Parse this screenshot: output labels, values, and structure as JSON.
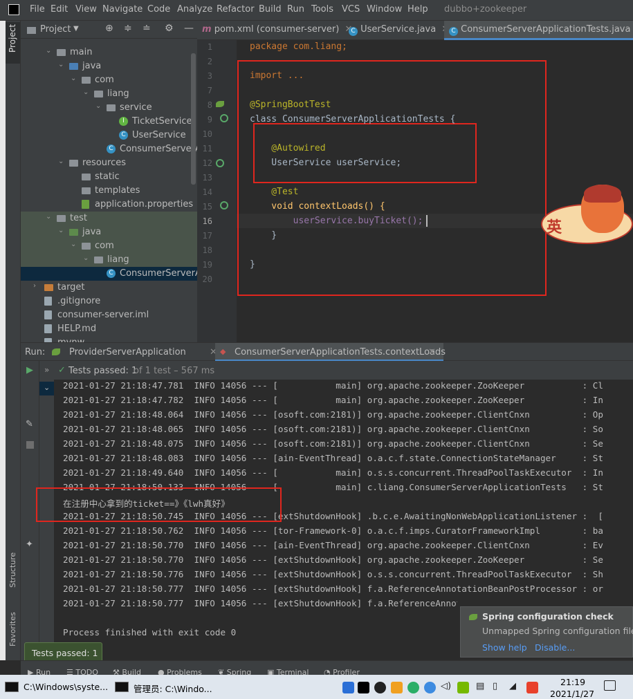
{
  "menubar": {
    "items": [
      "File",
      "Edit",
      "View",
      "Navigate",
      "Code",
      "Analyze",
      "Refactor",
      "Build",
      "Run",
      "Tools",
      "VCS",
      "Window",
      "Help"
    ],
    "project_title": "dubbo+zookeeper"
  },
  "project_panel": {
    "title": "Project",
    "side_label": "Project",
    "tree": [
      {
        "label": "main",
        "type": "folder",
        "depth": 0,
        "expanded": true
      },
      {
        "label": "java",
        "type": "source-folder",
        "depth": 1,
        "expanded": true
      },
      {
        "label": "com",
        "type": "package",
        "depth": 2,
        "expanded": true
      },
      {
        "label": "liang",
        "type": "package",
        "depth": 3,
        "expanded": true
      },
      {
        "label": "service",
        "type": "package",
        "depth": 4,
        "expanded": true
      },
      {
        "label": "TicketService",
        "type": "interface",
        "depth": 5
      },
      {
        "label": "UserService",
        "type": "class",
        "depth": 5
      },
      {
        "label": "ConsumerServerAp",
        "type": "class",
        "depth": 4
      },
      {
        "label": "resources",
        "type": "folder",
        "depth": 1,
        "expanded": true
      },
      {
        "label": "static",
        "type": "folder",
        "depth": 2
      },
      {
        "label": "templates",
        "type": "folder",
        "depth": 2
      },
      {
        "label": "application.properties",
        "type": "properties",
        "depth": 2
      },
      {
        "label": "test",
        "type": "folder",
        "depth": 0,
        "expanded": true
      },
      {
        "label": "java",
        "type": "test-folder",
        "depth": 1,
        "expanded": true
      },
      {
        "label": "com",
        "type": "package",
        "depth": 2,
        "expanded": true
      },
      {
        "label": "liang",
        "type": "package",
        "depth": 3,
        "expanded": true
      },
      {
        "label": "ConsumerServerAp",
        "type": "class",
        "depth": 4,
        "selected": true
      },
      {
        "label": "target",
        "type": "folder-orange",
        "depth": -1,
        "expanded": false
      },
      {
        "label": ".gitignore",
        "type": "file",
        "depth": -1
      },
      {
        "label": "consumer-server.iml",
        "type": "file",
        "depth": -1
      },
      {
        "label": "HELP.md",
        "type": "file",
        "depth": -1
      },
      {
        "label": "mvnw",
        "type": "file",
        "depth": -1
      }
    ]
  },
  "editor_tabs": [
    {
      "label": "pom.xml (consumer-server)",
      "icon": "maven-icon",
      "active": false
    },
    {
      "label": "UserService.java",
      "icon": "class-icon",
      "active": false
    },
    {
      "label": "ConsumerServerApplicationTests.java",
      "icon": "class-icon",
      "active": true
    }
  ],
  "code_lines": [
    {
      "n": "1",
      "text": "package com.liang;"
    },
    {
      "n": "2",
      "text": ""
    },
    {
      "n": "3",
      "text": "import ..."
    },
    {
      "n": "7",
      "text": ""
    },
    {
      "n": "8",
      "text": "@SpringBootTest"
    },
    {
      "n": "9",
      "text": "class ConsumerServerApplicationTests {"
    },
    {
      "n": "10",
      "text": ""
    },
    {
      "n": "11",
      "text": "    @Autowired"
    },
    {
      "n": "12",
      "text": "    UserService userService;"
    },
    {
      "n": "13",
      "text": ""
    },
    {
      "n": "14",
      "text": "    @Test"
    },
    {
      "n": "15",
      "text": "    void contextLoads() {"
    },
    {
      "n": "16",
      "text": "        userService.buyTicket();"
    },
    {
      "n": "17",
      "text": "    }"
    },
    {
      "n": "18",
      "text": ""
    },
    {
      "n": "19",
      "text": "}"
    },
    {
      "n": "20",
      "text": ""
    }
  ],
  "run_panel": {
    "label": "Run:",
    "tabs": [
      "ProviderServerApplication",
      "ConsumerServerApplicationTests.contextLoads"
    ],
    "tests_passed": "Tests passed: 1",
    "tests_detail": "of 1 test – 567 ms",
    "log_lines": [
      "2021-01-27 21:18:47.781  INFO 14056 --- [           main] org.apache.zookeeper.ZooKeeper           : Cl",
      "2021-01-27 21:18:47.782  INFO 14056 --- [           main] org.apache.zookeeper.ZooKeeper           : In",
      "2021-01-27 21:18:48.064  INFO 14056 --- [osoft.com:2181)] org.apache.zookeeper.ClientCnxn          : Op",
      "2021-01-27 21:18:48.065  INFO 14056 --- [osoft.com:2181)] org.apache.zookeeper.ClientCnxn          : So",
      "2021-01-27 21:18:48.075  INFO 14056 --- [osoft.com:2181)] org.apache.zookeeper.ClientCnxn          : Se",
      "2021-01-27 21:18:48.083  INFO 14056 --- [ain-EventThread] o.a.c.f.state.ConnectionStateManager     : St",
      "2021-01-27 21:18:49.640  INFO 14056 --- [           main] o.s.s.concurrent.ThreadPoolTaskExecutor  : In",
      "2021-01-27 21:18:50.133  INFO 14056 --- [           main] c.liang.ConsumerServerApplicationTests   : St",
      "在注册中心拿到的ticket==》《lwh真好》",
      "2021-01-27 21:18:50.745  INFO 14056 --- [extShutdownHook] .b.c.e.AwaitingNonWebApplicationListener :  [",
      "2021-01-27 21:18:50.762  INFO 14056 --- [tor-Framework-0] o.a.c.f.imps.CuratorFrameworkImpl        : ba",
      "2021-01-27 21:18:50.770  INFO 14056 --- [ain-EventThread] org.apache.zookeeper.ClientCnxn          : Ev",
      "2021-01-27 21:18:50.770  INFO 14056 --- [extShutdownHook] org.apache.zookeeper.ZooKeeper           : Se",
      "2021-01-27 21:18:50.776  INFO 14056 --- [extShutdownHook] o.s.s.concurrent.ThreadPoolTaskExecutor  : Sh",
      "2021-01-27 21:18:50.777  INFO 14056 --- [extShutdownHook] f.a.ReferenceAnnotationBeanPostProcessor : or",
      "2021-01-27 21:18:50.777  INFO 14056 --- [extShutdownHook] f.a.ReferenceAnnotationBeanPostProcessor : ",
      "",
      "Process finished with exit code 0"
    ]
  },
  "notification": {
    "title": "Spring configuration check",
    "body": "Unmapped Spring configuration files",
    "actions": [
      "Show help",
      "Disable..."
    ]
  },
  "tooltip": "Tests passed: 1",
  "side_labels": {
    "structure": "Structure",
    "favorites": "Favorites"
  },
  "bottom_tools": [
    "Run",
    "TODO",
    "Build",
    "Problems",
    "Spring",
    "Terminal",
    "Profiler"
  ],
  "sticker_text": "英",
  "taskbar": {
    "tasks": [
      "C:\\Windows\\syste...",
      "管理员: C:\\Windo..."
    ],
    "time": "21:19",
    "date": "2021/1/27"
  },
  "colors": {
    "accent": "#3592c4",
    "red_box": "#e0261e",
    "selection": "#0d293e",
    "test_bg": "#354535"
  }
}
